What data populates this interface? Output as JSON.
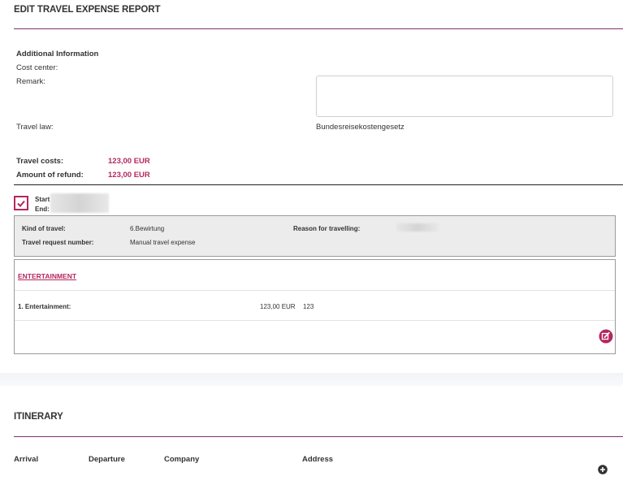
{
  "report": {
    "title": "EDIT TRAVEL EXPENSE REPORT",
    "additional_info": {
      "heading": "Additional Information",
      "cost_center_label": "Cost center:",
      "remark_label": "Remark:",
      "remark_value": "",
      "travel_law_label": "Travel law:",
      "travel_law_value": "Bundesreisekostengesetz"
    },
    "totals": {
      "travel_costs_label": "Travel costs:",
      "travel_costs_value": "123,00 EUR",
      "refund_label": "Amount of refund:",
      "refund_value": "123,00 EUR"
    },
    "trip": {
      "checked": true,
      "start_label": "Start",
      "end_label": "End:",
      "kind_label": "Kind of travel:",
      "kind_value": "6.Bewirtung",
      "reason_label": "Reason for travelling:",
      "request_label": "Travel request number:",
      "request_value": "Manual travel expense"
    },
    "expenses": {
      "section_link": "ENTERTAINMENT",
      "items": [
        {
          "label": "1. Entertainment:",
          "amount": "123,00 EUR",
          "ref": "123"
        }
      ]
    }
  },
  "itinerary": {
    "title": "ITINERARY",
    "columns": [
      "Arrival",
      "Departure",
      "Company",
      "Address"
    ]
  },
  "colors": {
    "accent": "#b5275e",
    "rule": "#7d3370"
  },
  "icons": {
    "checkbox": "check-icon",
    "edit": "edit-icon",
    "add": "add-icon"
  }
}
